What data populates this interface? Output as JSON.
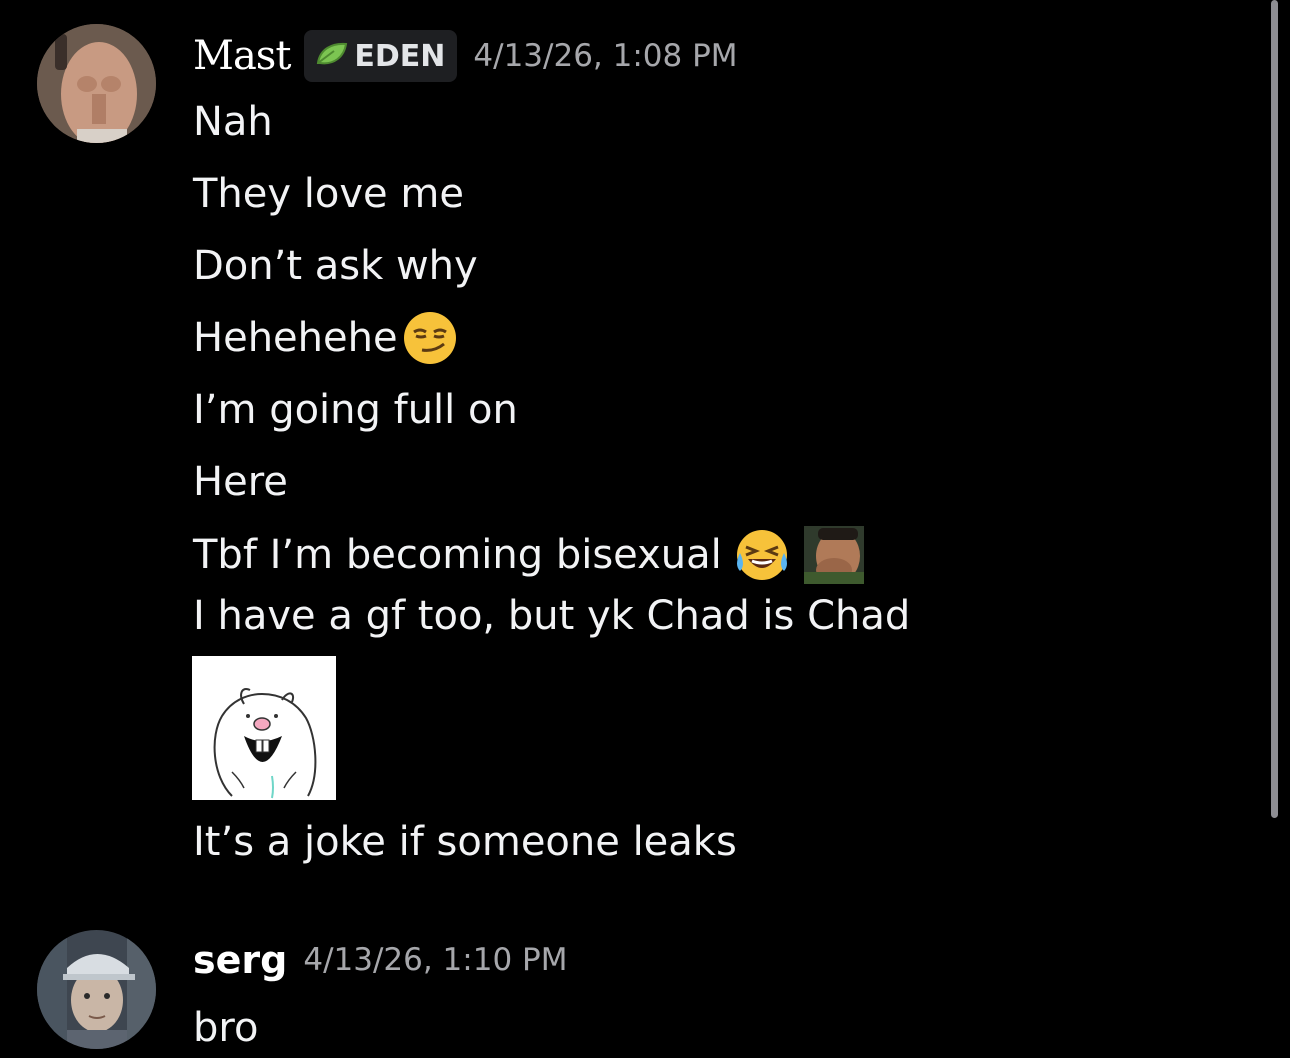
{
  "messages": [
    {
      "author": "Mast",
      "tag": "EDEN",
      "timestamp": "4/13/26, 1:08 PM",
      "lines": [
        "Nah",
        "They love me",
        "Don’t ask why",
        "Hehehehe",
        "I’m going full on",
        "Here",
        "Tbf I’m becoming bisexual",
        "I have a gf too, but yk Chad is Chad",
        "It’s a joke if someone leaks"
      ],
      "emojis": {
        "line4": "smirking-face-emoji",
        "line7a": "face-with-tears-of-joy-emoji",
        "line7b": "custom-chad-emoji"
      }
    },
    {
      "author": "serg",
      "timestamp": "4/13/26, 1:10 PM",
      "lines": [
        "bro"
      ]
    }
  ],
  "colors": {
    "background": "#000000",
    "text": "#f2f3f5",
    "timestamp": "#a6a7ab",
    "tag_bg": "#1e1f22",
    "tag_icon": "#6fbf4a"
  }
}
